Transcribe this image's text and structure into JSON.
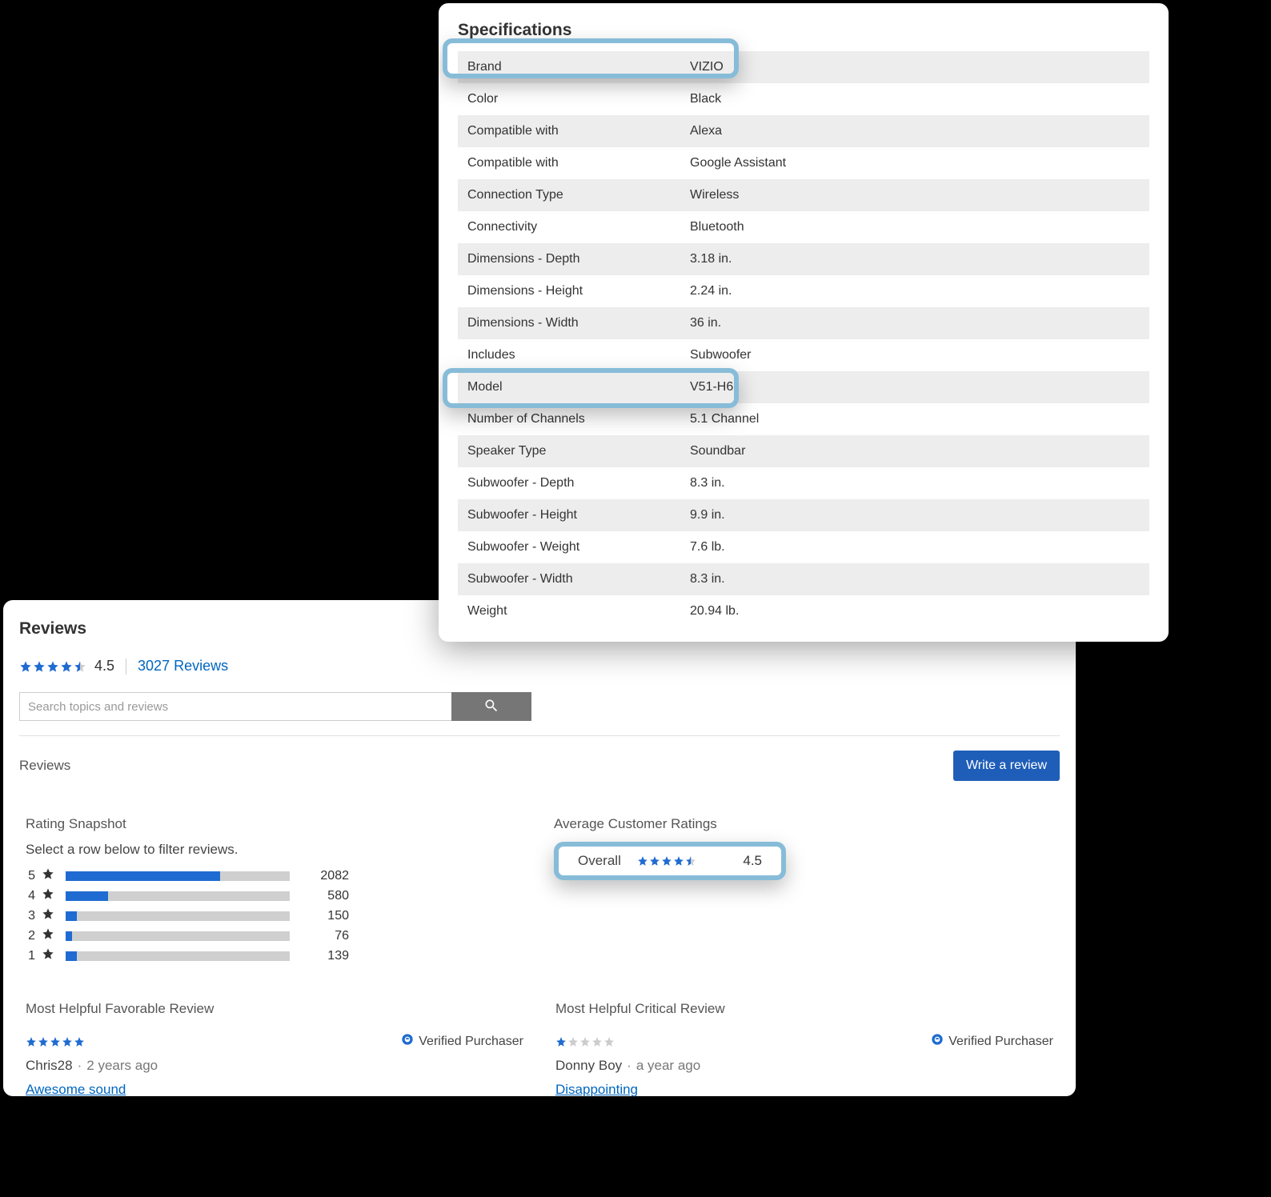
{
  "specs": {
    "title": "Specifications",
    "rows": [
      {
        "key": "Brand",
        "value": "VIZIO"
      },
      {
        "key": "Color",
        "value": "Black"
      },
      {
        "key": "Compatible with",
        "value": "Alexa"
      },
      {
        "key": "Compatible with",
        "value": "Google Assistant"
      },
      {
        "key": "Connection Type",
        "value": "Wireless"
      },
      {
        "key": "Connectivity",
        "value": "Bluetooth"
      },
      {
        "key": "Dimensions - Depth",
        "value": "3.18 in."
      },
      {
        "key": "Dimensions - Height",
        "value": "2.24 in."
      },
      {
        "key": "Dimensions - Width",
        "value": "36 in."
      },
      {
        "key": "Includes",
        "value": "Subwoofer"
      },
      {
        "key": "Model",
        "value": "V51-H6"
      },
      {
        "key": "Number of Channels",
        "value": "5.1 Channel"
      },
      {
        "key": "Speaker Type",
        "value": "Soundbar"
      },
      {
        "key": "Subwoofer - Depth",
        "value": "8.3 in."
      },
      {
        "key": "Subwoofer - Height",
        "value": "9.9 in."
      },
      {
        "key": "Subwoofer - Weight",
        "value": "7.6 lb."
      },
      {
        "key": "Subwoofer - Width",
        "value": "8.3 in."
      },
      {
        "key": "Weight",
        "value": "20.94 lb."
      }
    ]
  },
  "reviews": {
    "title": "Reviews",
    "summary_score": "4.5",
    "summary_stars": 4.5,
    "count_link": "3027 Reviews",
    "search_placeholder": "Search topics and reviews",
    "sub_label": "Reviews",
    "write_label": "Write a review",
    "snapshot": {
      "title": "Rating Snapshot",
      "hint": "Select a row below to filter reviews.",
      "rows": [
        {
          "n": "5",
          "count": "2082",
          "pct": 69
        },
        {
          "n": "4",
          "count": "580",
          "pct": 19
        },
        {
          "n": "3",
          "count": "150",
          "pct": 5
        },
        {
          "n": "2",
          "count": "76",
          "pct": 3
        },
        {
          "n": "1",
          "count": "139",
          "pct": 5
        }
      ]
    },
    "average": {
      "title": "Average Customer Ratings",
      "overall_label": "Overall",
      "overall_stars": 4.5,
      "overall_score": "4.5"
    },
    "helpful": {
      "fav": {
        "title": "Most Helpful Favorable Review",
        "stars": 5,
        "verified": "Verified Purchaser",
        "author": "Chris28",
        "ago": "2 years ago",
        "headline": "Awesome sound"
      },
      "crit": {
        "title": "Most Helpful Critical Review",
        "stars": 1,
        "verified": "Verified Purchaser",
        "author": "Donny Boy",
        "ago": "a year ago",
        "headline": "Disappointing"
      }
    }
  }
}
